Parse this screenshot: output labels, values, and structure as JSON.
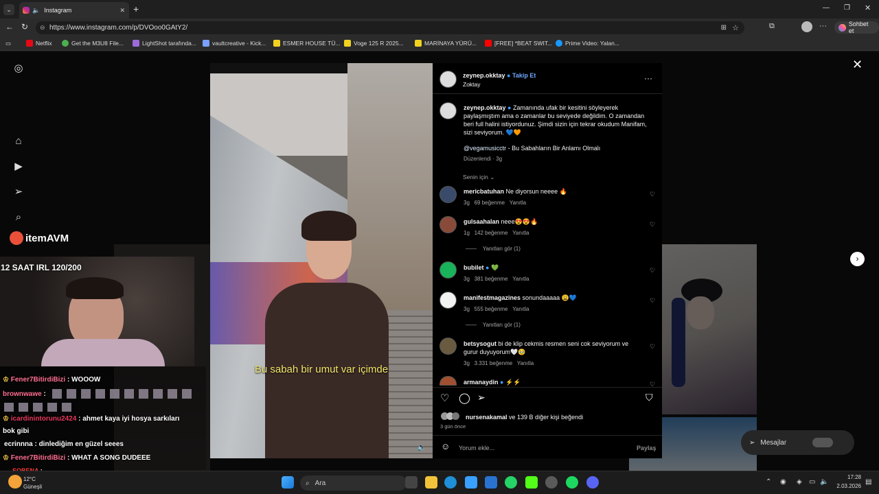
{
  "browser": {
    "tab_title": "Instagram",
    "url": "https://www.instagram.com/p/DVOoo0GAtY2/",
    "profile_btn": "Sohbet et",
    "bookmarks": [
      {
        "label": "Netflix",
        "color": "#e50914"
      },
      {
        "label": "Get the M3U8 File...",
        "color": "#4caf50"
      },
      {
        "label": "LightShot tarafında...",
        "color": "#9c6bd8"
      },
      {
        "label": "vaultcreative - Kick...",
        "color": "#7aa0ff"
      },
      {
        "label": "ESMER HOUSE TÜ...",
        "color": "#f2d21f"
      },
      {
        "label": "Voge 125 R 2025...",
        "color": "#f2d21f"
      },
      {
        "label": "MARİNAYA YÜRÜ...",
        "color": "#f2d21f"
      },
      {
        "label": "[FREE] *BEAT SWIT...",
        "color": "#ff0000"
      },
      {
        "label": "Prime Video: Yalan...",
        "color": "#1a98ff"
      }
    ]
  },
  "stream": {
    "brand": "itemAVM",
    "title": "12 SAAT IRL 120/200",
    "chat": [
      {
        "user": "Fener7BitirdiBizi",
        "user_color": "#ff6f91",
        "msg": ": WOOOW"
      },
      {
        "user": "brownwawe",
        "user_color": "#ff6f91",
        "msg": ":"
      },
      {
        "user": "icardinintorunu2424",
        "user_color": "#e8385d",
        "msg": ": ahmet kaya iyi hosya sarkıları"
      },
      {
        "user": "",
        "user_color": "#ffffff",
        "msg": "bok gibi"
      },
      {
        "user": "ecrinnna",
        "user_color": "#ffffff",
        "msg": ": dinlediğim en güzel seees"
      },
      {
        "user": "Fener7BitirdiBizi",
        "user_color": "#ff6f91",
        "msg": ": WHAT A SONG DUDEEE"
      },
      {
        "user": "SOBENA",
        "user_color": "#ff3a3a",
        "msg": ":"
      }
    ]
  },
  "video": {
    "subtitle": "Bu sabah bir umut var içimde"
  },
  "post": {
    "author": "zeynep.okktay",
    "follow": "Takip Et",
    "author_sub": "Zoktay",
    "caption": "Zamanında ufak bir kesitini söyleyerek paylaşmıştım ama o zamanlar bu seviyede değildim. O zamandan beri full halini istiyordunuz. Şimdi sizin için tekrar okudum Manifam, sizi seviyorum. 💙🧡",
    "mention": "@vegamusicctr",
    "song": " - Bu Sabahların Bir Anlamı Olmalı",
    "edited": "Düzenlendi · 3g",
    "sort": "Senin için",
    "comments": [
      {
        "user": "mericbatuhan",
        "text": "Ne diyorsun neeee 🔥",
        "time": "3g",
        "likes": "69 beğenme",
        "reply": "Yanıtla",
        "view": "",
        "avatar": "#3a4a6a"
      },
      {
        "user": "gulsaahalan",
        "text": "neee😍😍🔥",
        "time": "1g",
        "likes": "142 beğenme",
        "reply": "Yanıtla",
        "view": "Yanıtları gör (1)",
        "avatar": "#8a4a3a"
      },
      {
        "user": "bubilet",
        "text": "💚",
        "time": "3g",
        "likes": "381 beğenme",
        "reply": "Yanıtla",
        "view": "",
        "avatar": "#19b35a"
      },
      {
        "user": "manifestmagazines",
        "text": "sonundaaaaa 😩💙",
        "time": "3g",
        "likes": "555 beğenme",
        "reply": "Yanıtla",
        "view": "Yanıtları gör (1)",
        "avatar": "#f2f2f2"
      },
      {
        "user": "betsysogut",
        "text": "bi de klip cekmis resmen seni cok seviyorum ve gurur duyuyorum🤍🥹",
        "time": "3g",
        "likes": "3.331 beğenme",
        "reply": "Yanıtla",
        "view": "",
        "avatar": "#6a5a40"
      },
      {
        "user": "armanaydin",
        "text": "⚡⚡",
        "time": "",
        "likes": "",
        "reply": "",
        "view": "",
        "avatar": "#a05030"
      }
    ],
    "liked_by": "nursenakamal",
    "liked_rest": " ve 139 B diğer kişi beğendi",
    "posted": "3 gün önce",
    "comment_placeholder": "Yorum ekle...",
    "share": "Paylaş"
  },
  "messages": "Mesajlar",
  "taskbar": {
    "weather_temp": "12°C",
    "weather_desc": "Güneşli",
    "search": "Ara",
    "time": "17:28",
    "date": "2.03.2026"
  }
}
